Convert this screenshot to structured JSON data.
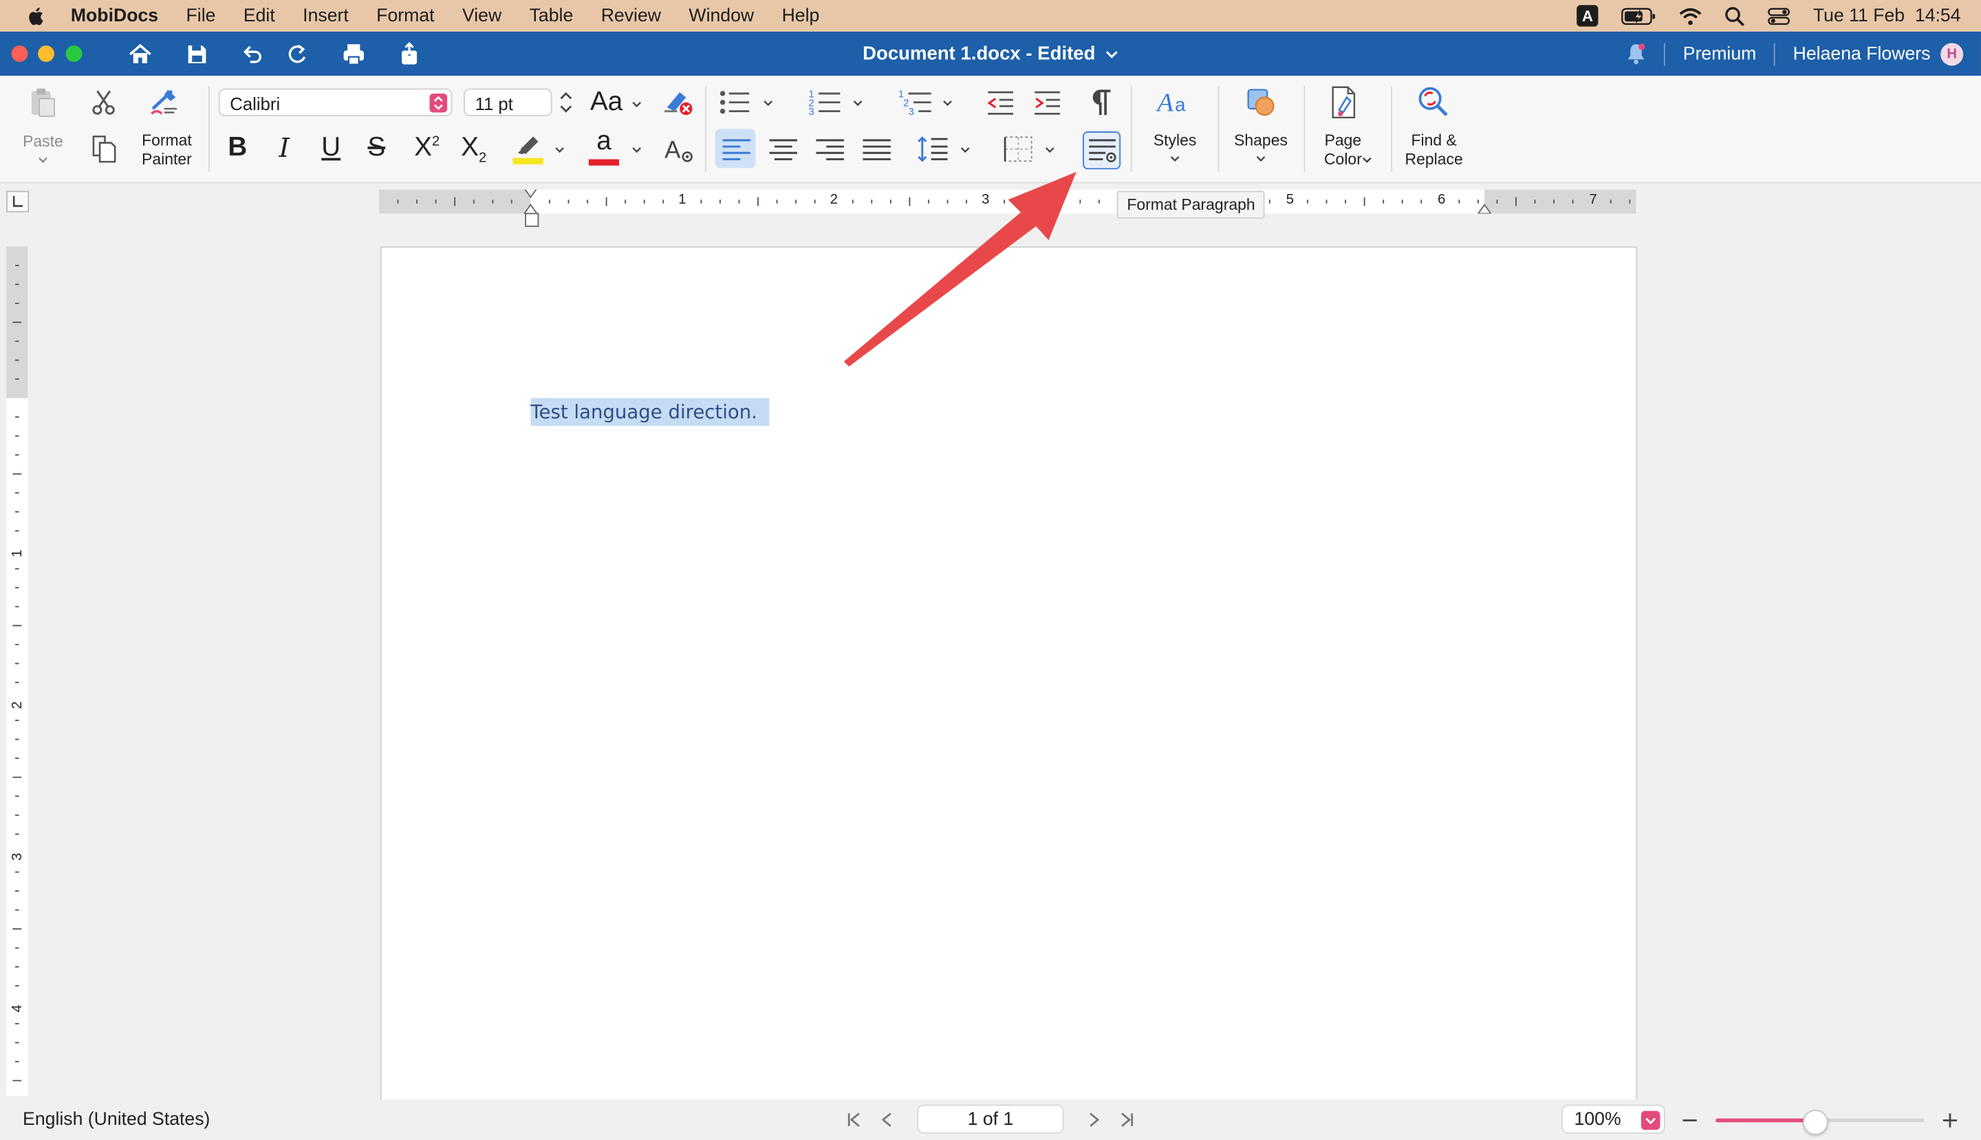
{
  "menubar": {
    "app": "MobiDocs",
    "items": [
      "File",
      "Edit",
      "Insert",
      "Format",
      "View",
      "Table",
      "Review",
      "Window",
      "Help"
    ],
    "date_time": "Tue 11 Feb  14:54",
    "input_source": "A"
  },
  "titlebar": {
    "document_title": "Document 1.docx - Edited",
    "premium": "Premium",
    "user_name": "Helaena Flowers",
    "avatar_initial": "H"
  },
  "ribbon": {
    "paste_label": "Paste",
    "format_painter_label": "Format\nPainter",
    "font_name": "Calibri",
    "font_size": "11 pt",
    "change_case_label": "Aa",
    "styles_label": "Styles",
    "shapes_label": "Shapes",
    "page_color_label": "Page\nColor",
    "find_replace_label": "Find &\nReplace",
    "bold": "B",
    "italic": "I",
    "underline": "U",
    "strike": "S",
    "superscript": "X",
    "subscript": "X",
    "superscript_mark": "2",
    "subscript_mark": "2",
    "font_color_letter": "a",
    "highlight_color": "#f5e51c",
    "font_color": "#e3202a"
  },
  "tooltip": "Format Paragraph",
  "ruler": {
    "h_numbers": [
      "1",
      "2",
      "3",
      "5",
      "6",
      "7"
    ],
    "v_numbers": [
      "1",
      "2",
      "3",
      "4"
    ]
  },
  "document": {
    "text": "Test language direction."
  },
  "statusbar": {
    "language": "English (United States)",
    "page_indicator": "1 of 1",
    "zoom": "100%",
    "zoom_level_fraction": 0.47
  },
  "colors": {
    "menubar_bg": "#e8c7a8",
    "titlebar_bg": "#1d5fa8",
    "accent_pink": "#e34b7b",
    "selection": "#c6dcf4",
    "annotation_arrow": "#e8484a"
  }
}
